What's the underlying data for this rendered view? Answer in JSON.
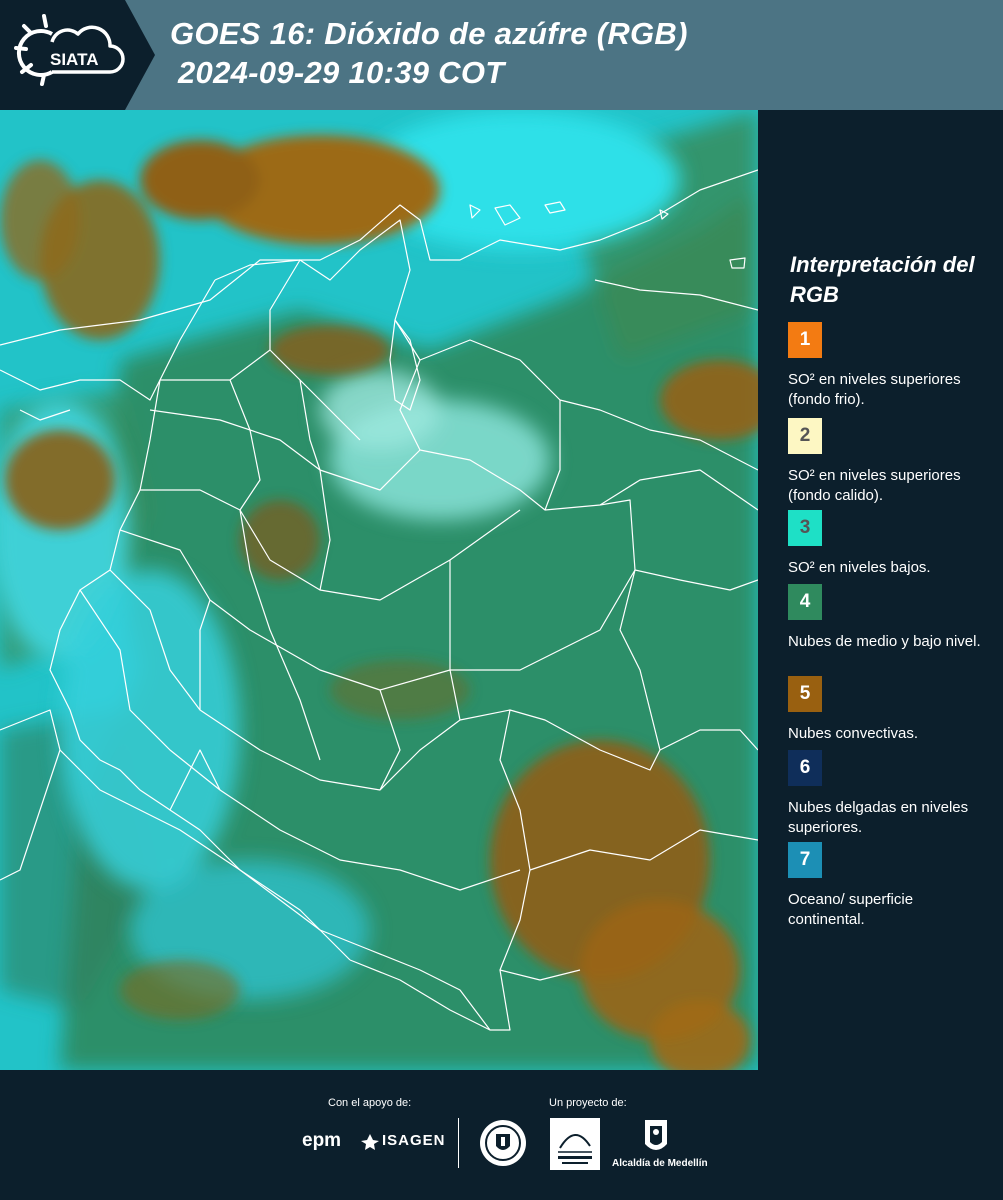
{
  "header": {
    "logo_text": "SIATA",
    "title_line1": "GOES 16: Dióxido de azúfre (RGB)",
    "title_line2": "2024-09-29 10:39 COT"
  },
  "map": {
    "image_description_icon": "satellite-rgb-image",
    "colors": {
      "so2_cold": "#f37b12",
      "so2_warm": "#fdf7c3",
      "so2_low": "#1ee0c6",
      "mid_low_clouds": "#2f8a5e",
      "convective": "#996010",
      "thin_high": "#0f2e5a",
      "ocean_surface": "#1c8fb5"
    }
  },
  "legend": {
    "title": "Interpretación del RGB",
    "items": [
      {
        "number": "1",
        "label": "SO² en niveles superiores (fondo frio).",
        "color": "#f37b12",
        "text_color": "#ffffff"
      },
      {
        "number": "2",
        "label": "SO² en niveles superiores (fondo calido).",
        "color": "#fdf7c3",
        "text_color": "#555555"
      },
      {
        "number": "3",
        "label": "SO² en niveles bajos.",
        "color": "#1ee0c6",
        "text_color": "#555555"
      },
      {
        "number": "4",
        "label": "Nubes de medio y bajo nivel.",
        "color": "#2f8a5e",
        "text_color": "#ffffff"
      },
      {
        "number": "5",
        "label": "Nubes convectivas.",
        "color": "#996010",
        "text_color": "#ffffff"
      },
      {
        "number": "6",
        "label": "Nubes delgadas en niveles superiores.",
        "color": "#0f2e5a",
        "text_color": "#ffffff"
      },
      {
        "number": "7",
        "label": "Oceano/ superficie continental.",
        "color": "#1c8fb5",
        "text_color": "#ffffff"
      }
    ]
  },
  "footer": {
    "support_caption": "Con el apoyo de:",
    "project_caption": "Un proyecto de:",
    "epm_logo": "epm",
    "isagen_logo": "ISAGEN",
    "alcaldia_caption": "Alcaldía de Medellín"
  }
}
